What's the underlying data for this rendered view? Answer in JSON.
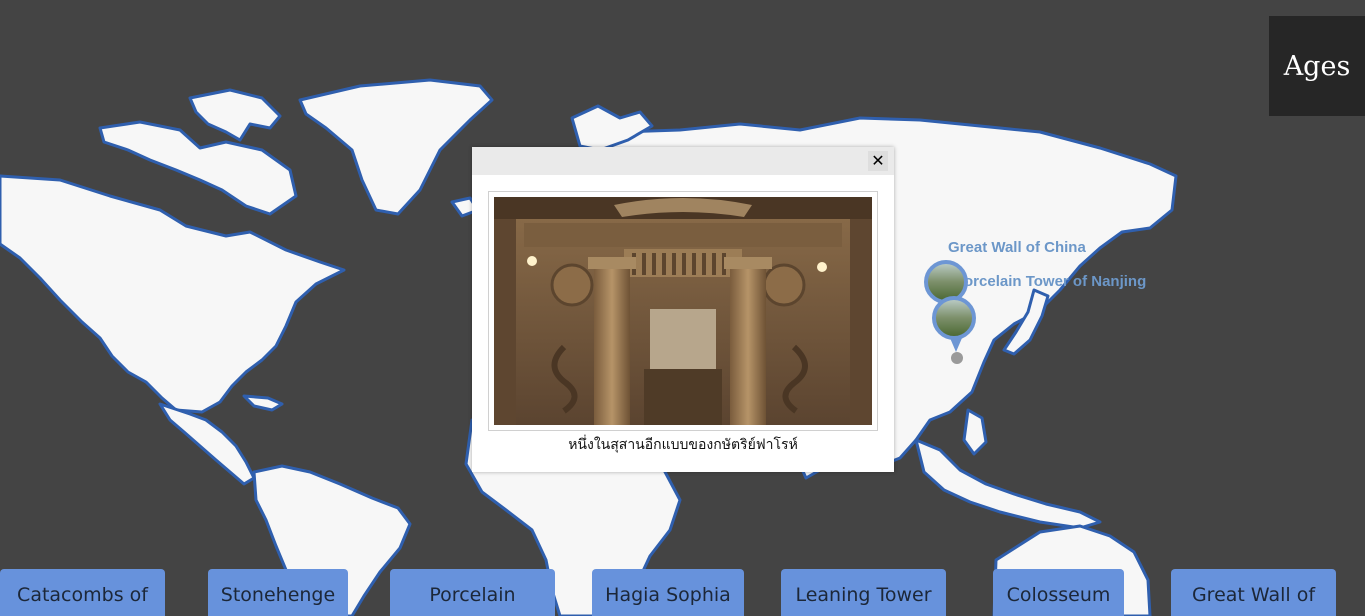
{
  "ages_button": {
    "label": "Ages"
  },
  "markers": [
    {
      "label": "Great Wall of China"
    },
    {
      "label": "Porcelain Tower of Nanjing"
    }
  ],
  "popup": {
    "close_label": "✕",
    "caption": "หนึ่งในสุสานอีกแบบของกษัตริย์ฟาโรห์"
  },
  "bottom_tabs": [
    {
      "label": "Catacombs of"
    },
    {
      "label": "Stonehenge"
    },
    {
      "label": "Porcelain"
    },
    {
      "label": "Hagia Sophia"
    },
    {
      "label": "Leaning Tower"
    },
    {
      "label": "Colosseum"
    },
    {
      "label": "Great Wall of"
    }
  ],
  "colors": {
    "background": "#444444",
    "land": "#f7f7f7",
    "land_outline": "#2f5fae",
    "tab_button": "#6792dc",
    "marker_label": "#6c97c8",
    "ages_box": "#262626"
  }
}
